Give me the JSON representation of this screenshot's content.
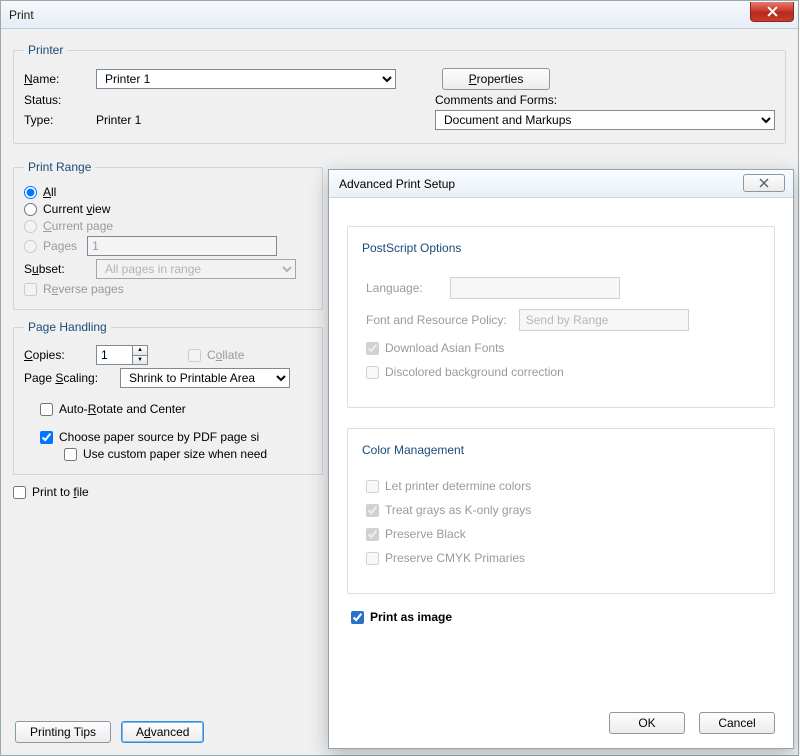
{
  "print": {
    "title": "Print",
    "printer_legend": "Printer",
    "name_label": "Name:",
    "name_value": "Printer 1",
    "properties_btn": "Properties",
    "status_label": "Status:",
    "status_value": "",
    "type_label": "Type:",
    "type_value": "Printer 1",
    "comments_label": "Comments and Forms:",
    "comments_value": "Document and Markups",
    "range_legend": "Print Range",
    "range": {
      "all": "All",
      "current_view": "Current view",
      "current_page": "Current page",
      "pages": "Pages",
      "pages_value": "1",
      "subset_label": "Subset:",
      "subset_value": "All pages in range",
      "reverse": "Reverse pages"
    },
    "handling_legend": "Page Handling",
    "handling": {
      "copies_label": "Copies:",
      "copies_value": "1",
      "collate": "Collate",
      "scaling_label": "Page Scaling:",
      "scaling_value": "Shrink to Printable Area",
      "auto_rotate": "Auto-Rotate and Center",
      "choose_paper": "Choose paper source by PDF page si",
      "use_custom": "Use custom paper size when need"
    },
    "print_to_file": "Print to file",
    "printing_tips": "Printing Tips",
    "advanced_btn": "Advanced"
  },
  "advanced": {
    "title": "Advanced Print Setup",
    "ps_legend": "PostScript Options",
    "language_label": "Language:",
    "font_policy_label": "Font and Resource Policy:",
    "font_policy_value": "Send by Range",
    "download_asian": "Download Asian Fonts",
    "discolored": "Discolored background correction",
    "cm_legend": "Color Management",
    "let_printer": "Let printer determine colors",
    "treat_grays": "Treat grays as K-only grays",
    "preserve_black": "Preserve Black",
    "preserve_cmyk": "Preserve CMYK Primaries",
    "print_as_image": "Print as image",
    "ok": "OK",
    "cancel": "Cancel"
  }
}
